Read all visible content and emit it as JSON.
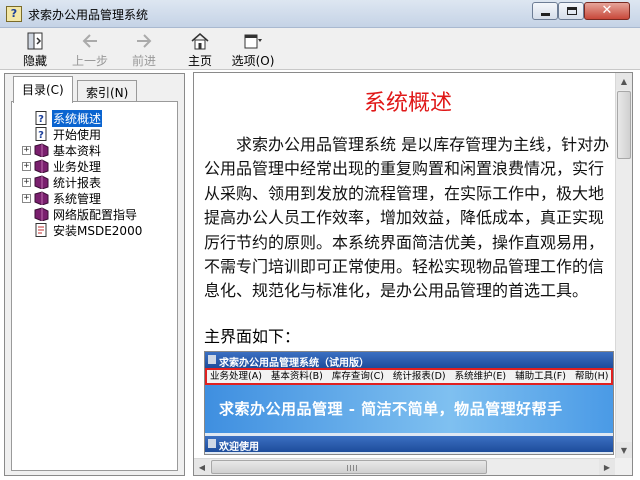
{
  "window": {
    "title": "求索办公用品管理系统",
    "app_icon_glyph": "?"
  },
  "toolbar": {
    "buttons": [
      {
        "icon": "hide-icon",
        "label": "隐藏",
        "enabled": true
      },
      {
        "icon": "back-arrow-icon",
        "label": "上一步",
        "enabled": false
      },
      {
        "icon": "forward-arrow-icon",
        "label": "前进",
        "enabled": false
      },
      {
        "icon": "home-icon",
        "label": "主页",
        "enabled": true
      },
      {
        "icon": "options-icon",
        "label": "选项(O)",
        "enabled": true
      }
    ]
  },
  "nav": {
    "tabs": [
      {
        "label": "目录(C)",
        "active": true
      },
      {
        "label": "索引(N)",
        "active": false
      }
    ],
    "tree": [
      {
        "label": "系统概述",
        "icon": "help-page-icon",
        "expandable": false,
        "selected": true
      },
      {
        "label": "开始使用",
        "icon": "help-page-icon",
        "expandable": false,
        "selected": false
      },
      {
        "label": "基本资料",
        "icon": "book-icon",
        "expandable": true,
        "selected": false
      },
      {
        "label": "业务处理",
        "icon": "book-icon",
        "expandable": true,
        "selected": false
      },
      {
        "label": "统计报表",
        "icon": "book-icon",
        "expandable": true,
        "selected": false
      },
      {
        "label": "系统管理",
        "icon": "book-icon",
        "expandable": true,
        "selected": false
      },
      {
        "label": "网络版配置指导",
        "icon": "book-icon",
        "expandable": false,
        "selected": false
      },
      {
        "label": "安装MSDE2000",
        "icon": "doc-page-icon",
        "expandable": false,
        "selected": false
      }
    ],
    "expand_glyph": "+"
  },
  "article": {
    "title": "系统概述",
    "paragraph": "求索办公用品管理系统 是以库存管理为主线，针对办公用品管理中经常出现的重复购置和闲置浪费情况，实行从采购、领用到发放的流程管理，在实际工作中，极大地提高办公人员工作效率，增加效益，降低成本，真正实现厉行节约的原则。本系统界面简洁优美，操作直观易用，不需专门培训即可正常使用。轻松实现物品管理工作的信息化、规范化与标准化，是办公用品管理的首选工具。",
    "subheading": "主界面如下：",
    "screenshot": {
      "title": "求索办公用品管理系统（试用版）",
      "menu": [
        "业务处理(A)",
        "基本资料(B)",
        "库存查询(C)",
        "统计报表(D)",
        "系统维护(E)",
        "辅助工具(F)",
        "帮助(H)"
      ],
      "banner": "求索办公用品管理 - 简洁不简单，物品管理好帮手",
      "welcome": "欢迎使用"
    }
  },
  "colors": {
    "title_red": "#e01818",
    "selection_blue": "#0a64d0"
  }
}
